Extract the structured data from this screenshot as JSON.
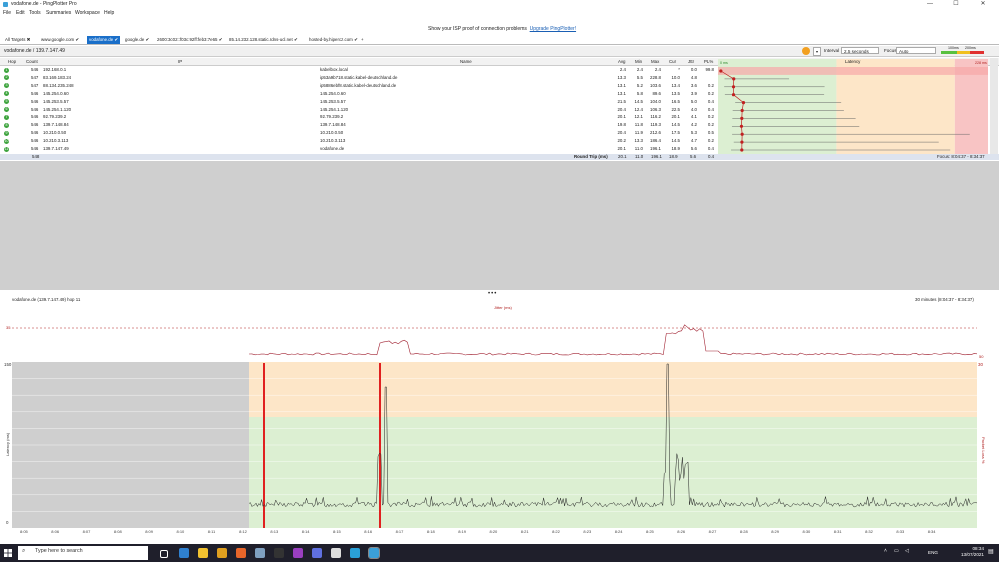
{
  "window": {
    "title": "vodafone.de - PingPlotter Pro",
    "controls": [
      "—",
      "☐",
      "✕"
    ]
  },
  "menu": [
    "File",
    "Edit",
    "Tools",
    "Summaries",
    "Workspace",
    "Help"
  ],
  "promo": {
    "text": "Show your ISP proof of connection problems",
    "link": "Upgrade PingPlotter!"
  },
  "tabs": [
    {
      "label": "All Targets",
      "active": false
    },
    {
      "label": "www.google.com",
      "active": false
    },
    {
      "label": "vodafone.de",
      "active": true
    },
    {
      "label": "google.de",
      "active": false
    },
    {
      "label": "2600:3c02::f03c:92ff:feb3:7e65",
      "active": false
    },
    {
      "label": "85.14.232.128.static.rdns-ucl.net",
      "active": false
    },
    {
      "label": "hosted-by.hipercz.com",
      "active": false
    }
  ],
  "toolbar": {
    "breadcrumb": "vodafone.de / 139.7.147.49",
    "interval_label": "Interval",
    "interval_value": "2.5 seconds",
    "focus_label": "Focus",
    "focus_value": "Auto",
    "legend_100": "100ms",
    "legend_200": "200ms"
  },
  "table": {
    "headers": {
      "hop": "Hop",
      "count": "Count",
      "ip": "IP",
      "name": "Name",
      "avg": "Avg",
      "min": "Min",
      "max": "Max",
      "cur": "Cur",
      "jttr": "Jttr",
      "pl": "PL%",
      "latency": "Latency",
      "scale_0": "0 ms",
      "scale_max": "228 ms"
    },
    "rows": [
      {
        "hop": "1",
        "count": "546",
        "ip": "192.168.0.1",
        "name": "kabelbox.local",
        "avg": "2.4",
        "min": "2.4",
        "max": "2.4",
        "cur": "*",
        "jttr": "0.0",
        "pl": "99.8",
        "ms": 2.4,
        "range": [
          2.4,
          2.4
        ]
      },
      {
        "hop": "2",
        "count": "547",
        "ip": "83.169.183.24",
        "name": "ip53a9b718.static.kabel-deutschland.de",
        "avg": "13.3",
        "min": "5.5",
        "max": "228.8",
        "cur": "10.0",
        "jttr": "4.8",
        "pl": "",
        "ms": 13.3,
        "range": [
          5.5,
          60
        ]
      },
      {
        "hop": "3",
        "count": "547",
        "ip": "88.134.235.248",
        "name": "ip5886ebf8.static.kabel-deutschland.de",
        "avg": "13.1",
        "min": "5.2",
        "max": "103.6",
        "cur": "13.4",
        "jttr": "3.6",
        "pl": "0.2",
        "ms": 13.1,
        "range": [
          5.2,
          90
        ]
      },
      {
        "hop": "4",
        "count": "546",
        "ip": "145.254.0.60",
        "name": "145.254.0.60",
        "avg": "13.1",
        "min": "5.8",
        "max": "89.6",
        "cur": "13.5",
        "jttr": "3.9",
        "pl": "0.2",
        "ms": 13.1,
        "range": [
          5.8,
          89.6
        ]
      },
      {
        "hop": "5",
        "count": "546",
        "ip": "145.253.5.57",
        "name": "145.253.5.57",
        "avg": "21.5",
        "min": "14.5",
        "max": "104.0",
        "cur": "16.5",
        "jttr": "5.0",
        "pl": "0.4",
        "ms": 21.5,
        "range": [
          14.5,
          104
        ]
      },
      {
        "hop": "6",
        "count": "546",
        "ip": "145.254.1.120",
        "name": "145.254.1.120",
        "avg": "20.4",
        "min": "12.4",
        "max": "106.3",
        "cur": "22.5",
        "jttr": "4.0",
        "pl": "0.4",
        "ms": 20.4,
        "range": [
          12.4,
          106.3
        ]
      },
      {
        "hop": "7",
        "count": "546",
        "ip": "92.79.239.2",
        "name": "92.79.239.2",
        "avg": "20.1",
        "min": "12.1",
        "max": "116.2",
        "cur": "20.1",
        "jttr": "4.1",
        "pl": "0.2",
        "ms": 20.1,
        "range": [
          12.1,
          116.2
        ]
      },
      {
        "hop": "8",
        "count": "546",
        "ip": "139.7.148.84",
        "name": "139.7.148.84",
        "avg": "19.8",
        "min": "11.8",
        "max": "119.3",
        "cur": "14.5",
        "jttr": "4.2",
        "pl": "0.2",
        "ms": 19.8,
        "range": [
          11.8,
          119.3
        ]
      },
      {
        "hop": "9",
        "count": "546",
        "ip": "10.210.0.50",
        "name": "10.210.0.50",
        "avg": "20.4",
        "min": "11.9",
        "max": "212.6",
        "cur": "17.5",
        "jttr": "5.3",
        "pl": "0.5",
        "ms": 20.4,
        "range": [
          11.9,
          212.6
        ]
      },
      {
        "hop": "10",
        "count": "546",
        "ip": "10.210.3.113",
        "name": "10.210.3.113",
        "avg": "20.2",
        "min": "13.3",
        "max": "186.4",
        "cur": "14.5",
        "jttr": "4.7",
        "pl": "0.2",
        "ms": 20.2,
        "range": [
          13.3,
          186.4
        ]
      },
      {
        "hop": "11",
        "count": "546",
        "ip": "139.7.147.49",
        "name": "vodafone.de",
        "avg": "20.1",
        "min": "11.0",
        "max": "196.1",
        "cur": "18.9",
        "jttr": "5.6",
        "pl": "0.4",
        "ms": 20.1,
        "range": [
          11.0,
          196.1
        ]
      }
    ],
    "roundtrip": {
      "count": "548",
      "label": "Round Trip (ms)",
      "avg": "20.1",
      "min": "11.0",
      "max": "196.1",
      "cur": "18.9",
      "jttr": "5.6",
      "pl": "0.4",
      "focus": "Focus: 8:04:37 - 8:34:37"
    }
  },
  "lower": {
    "title": "vodafone.de (139.7.147.49) hop 11",
    "range": "30 minutes (8:04:37 - 8:34:37)",
    "jitter_title": "Jitter (ms)",
    "jitter_max_label": "35",
    "jitter_right_label": "50",
    "y_axis_label": "Latency (ms)",
    "right_axis_label": "Packet Loss %",
    "y_top_label": "150",
    "y_zero_label": "0",
    "right_top_label": "30",
    "x_ticks": [
      "8:05",
      "8:06",
      "8:07",
      "8:08",
      "8:09",
      "8:10",
      "8:11",
      "8:12",
      "8:13",
      "8:14",
      "8:15",
      "8:16",
      "8:17",
      "8:18",
      "8:19",
      "8:20",
      "8:21",
      "8:22",
      "8:23",
      "8:24",
      "8:25",
      "8:26",
      "8:27",
      "8:28",
      "8:29",
      "8:30",
      "8:31",
      "8:32",
      "8:33",
      "8:34"
    ]
  },
  "taskbar": {
    "search": "Type here to search",
    "lang": "ENG",
    "time": "08:34",
    "date": "13/07/2021",
    "apps": [
      {
        "name": "task-view-icon",
        "color": "#ffffff"
      },
      {
        "name": "vscode-icon",
        "color": "#2f80d0"
      },
      {
        "name": "file-explorer-icon",
        "color": "#f2c230"
      },
      {
        "name": "chrome-icon",
        "color": "#e0a020"
      },
      {
        "name": "firefox-icon",
        "color": "#e8662a"
      },
      {
        "name": "steam-icon",
        "color": "#7fa0c0"
      },
      {
        "name": "terminal-icon",
        "color": "#333333"
      },
      {
        "name": "obs-icon",
        "color": "#9a3fc0"
      },
      {
        "name": "discord-icon",
        "color": "#6070e0"
      },
      {
        "name": "settings-icon",
        "color": "#dddddd"
      },
      {
        "name": "app-icon",
        "color": "#2aa0d8"
      },
      {
        "name": "pingplotter-icon",
        "color": "#3ba0d8"
      }
    ]
  },
  "colors": {
    "green": "#d6f0cc",
    "orange": "#fde6c8",
    "red": "#f8c4c4",
    "accent": "#1a6fc9",
    "lossbar": "#e02020"
  }
}
